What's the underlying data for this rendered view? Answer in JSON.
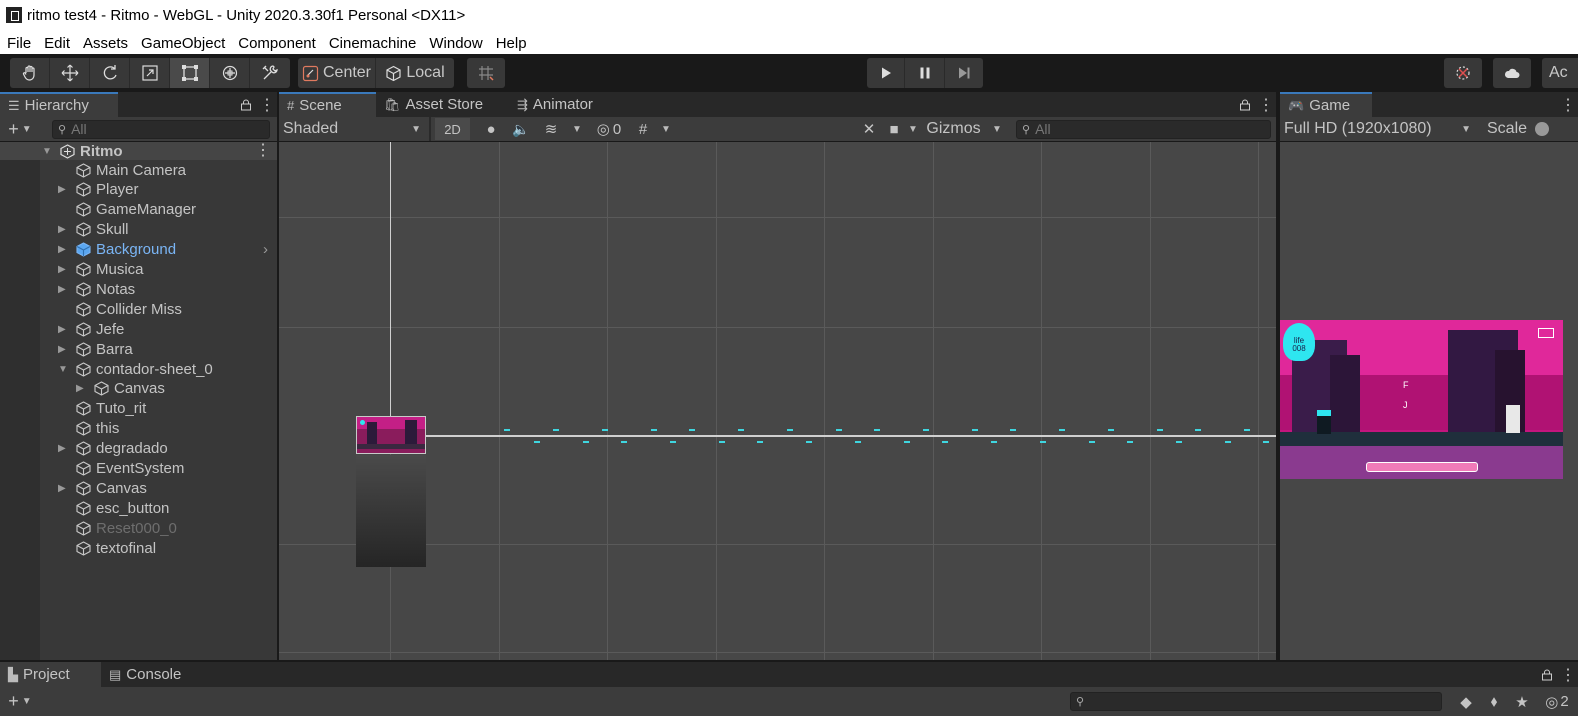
{
  "window": {
    "title": "ritmo test4 - Ritmo - WebGL - Unity 2020.3.30f1 Personal <DX11>"
  },
  "menu": [
    "File",
    "Edit",
    "Assets",
    "GameObject",
    "Component",
    "Cinemachine",
    "Window",
    "Help"
  ],
  "toolbar": {
    "pivot_label": "Center",
    "space_label": "Local",
    "account_label": "Ac"
  },
  "hierarchy": {
    "tab_label": "Hierarchy",
    "search_placeholder": "All",
    "scene_name": "Ritmo",
    "items": [
      {
        "label": "Main Camera",
        "expandable": false,
        "depth": 0
      },
      {
        "label": "Player",
        "expandable": true,
        "depth": 0
      },
      {
        "label": "GameManager",
        "expandable": false,
        "depth": 0
      },
      {
        "label": "Skull",
        "expandable": true,
        "depth": 0
      },
      {
        "label": "Background",
        "expandable": true,
        "depth": 0,
        "selected": true
      },
      {
        "label": "Musica",
        "expandable": true,
        "depth": 0
      },
      {
        "label": "Notas",
        "expandable": true,
        "depth": 0
      },
      {
        "label": "Collider Miss",
        "expandable": false,
        "depth": 0
      },
      {
        "label": "Jefe",
        "expandable": true,
        "depth": 0
      },
      {
        "label": "Barra",
        "expandable": true,
        "depth": 0
      },
      {
        "label": "contador-sheet_0",
        "expandable": true,
        "expanded": true,
        "depth": 0
      },
      {
        "label": "Canvas",
        "expandable": true,
        "depth": 1
      },
      {
        "label": "Tuto_rit",
        "expandable": false,
        "depth": 0
      },
      {
        "label": "this",
        "expandable": false,
        "depth": 0
      },
      {
        "label": "degradado",
        "expandable": true,
        "depth": 0
      },
      {
        "label": "EventSystem",
        "expandable": false,
        "depth": 0
      },
      {
        "label": "Canvas",
        "expandable": true,
        "depth": 0
      },
      {
        "label": "esc_button",
        "expandable": false,
        "depth": 0
      },
      {
        "label": "Reset000_0",
        "expandable": false,
        "depth": 0,
        "disabled": true
      },
      {
        "label": "textofinal",
        "expandable": false,
        "depth": 0
      }
    ]
  },
  "scene": {
    "tabs": [
      "Scene",
      "Asset Store",
      "Animator"
    ],
    "shading_mode": "Shaded",
    "mode_2d_label": "2D",
    "hidden_count": "0",
    "gizmos_label": "Gizmos",
    "search_placeholder": "All"
  },
  "game": {
    "tab_label": "Game",
    "resolution": "Full HD (1920x1080)",
    "scale_label": "Scale",
    "hud_life_label": "life",
    "hud_life_value": "008",
    "hud_letter_f": "F",
    "hud_letter_j": "J"
  },
  "bottom": {
    "tabs": [
      "Project",
      "Console"
    ],
    "hidden_count": "2"
  },
  "colors": {
    "accent": "#3a79bb",
    "selected_text": "#7ab5f5",
    "game_magenta": "#d4208c",
    "game_cyan": "#2ee6f0"
  }
}
